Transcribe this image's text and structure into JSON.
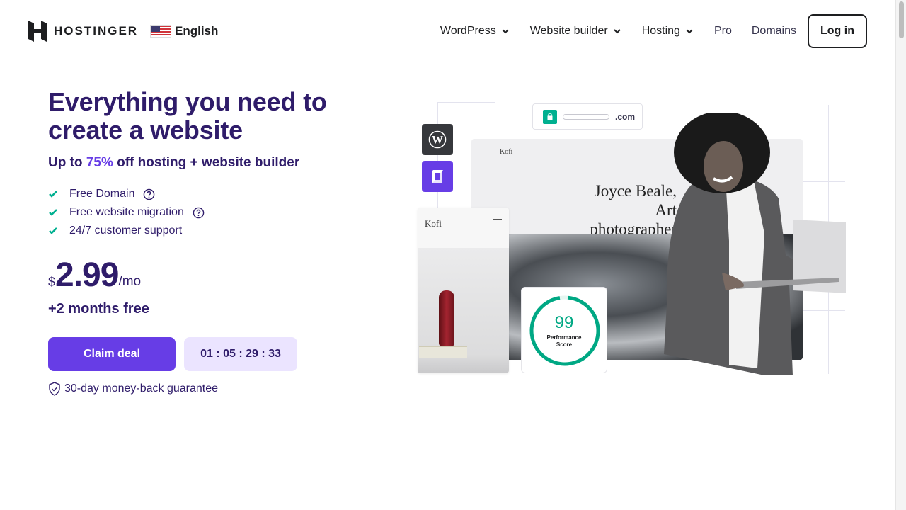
{
  "header": {
    "brand": "HOSTINGER",
    "language": "English",
    "nav": [
      {
        "label": "WordPress",
        "has_dropdown": true
      },
      {
        "label": "Website builder",
        "has_dropdown": true
      },
      {
        "label": "Hosting",
        "has_dropdown": true
      },
      {
        "label": "Pro",
        "has_dropdown": false
      },
      {
        "label": "Domains",
        "has_dropdown": false
      }
    ],
    "login_label": "Log in"
  },
  "hero": {
    "title": "Everything you need to create a website",
    "subtitle_prefix": "Up to ",
    "subtitle_accent": "75%",
    "subtitle_suffix": " off hosting + website builder",
    "features": [
      {
        "label": "Free Domain",
        "has_help": true
      },
      {
        "label": "Free website migration",
        "has_help": true
      },
      {
        "label": "24/7 customer support",
        "has_help": false
      }
    ],
    "price": {
      "currency": "$",
      "amount": "2.99",
      "period": "/mo"
    },
    "bonus": "+2 months free",
    "cta_label": "Claim deal",
    "timer": "01 : 05 : 29 : 33",
    "guarantee": "30-day money-back guarantee"
  },
  "illustration": {
    "url_tld": ".com",
    "site_brand": "Kofi",
    "site_title": "Joyce Beale, Art photographer",
    "mobile_brand": "Kofi",
    "performance_score": "99",
    "performance_label": "Performance Score",
    "performance_fraction": 0.99
  },
  "colors": {
    "primary": "#673de6",
    "heading": "#2f1c6a",
    "success": "#00b090",
    "timer_bg": "#ebe4ff"
  }
}
